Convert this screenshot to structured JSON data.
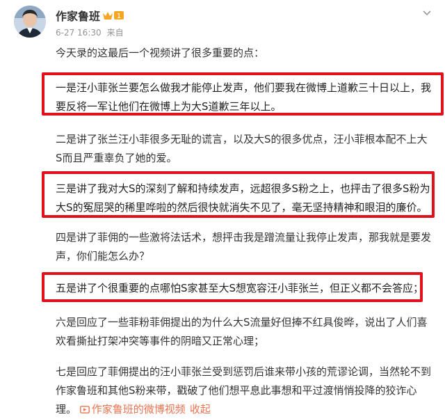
{
  "post": {
    "author": "作家鲁班",
    "badge_level": "1",
    "timestamp": "6-27 16:30",
    "source": "来自",
    "paragraphs": [
      "今天录的这最后一个视频讲了很多重要的点：",
      "一是汪小菲张兰要怎么做我才能停止发声，他们要我在微博上道歉三十日以上，我要反将一军让他们在微博上为大S道歉三年以上。",
      "二是讲了张兰汪小菲很多无耻的谎言，以及大S的很多优点，汪小菲根本配不上大S而且严重辜负了她的爱。",
      "三是讲了我对大S的深刻了解和持续发声，远超很多S粉之上，也抨击了很多S粉为大S的冤屈哭的稀里哗啦的然后很快就消失不见了，毫无坚持精神和眼泪的廉价。",
      "四是讲了菲佣的一些激将法话术，想抨击我是蹭流量让我停止发声，那我就是要发声，你们能怎么办？",
      "五是讲了个很重要的点哪怕S家甚至大S想宽容汪小菲张兰，但正义都不会答应；",
      "六是回应了一些菲粉菲佣提出的为什么大S流量好但捧不红具俊晔，说出了人们喜欢看撕扯打架冲突等事件的阴暗又正常心理；",
      "七是回应了菲佣提出的汪小菲张兰受到惩罚后谁来带小孩的荒谬论调，当然轮不到作家鲁班和其他S粉来带，戳破了他们想平息此事想和平过渡悄悄投降的狡诈心理。"
    ],
    "video_link": "作家鲁班的微博视频",
    "collapse_link": "收起"
  },
  "colors": {
    "highlight_box": "#e0111c",
    "link": "#eb7350",
    "badge": "#f5a623",
    "meta": "#939393"
  },
  "icons": [
    "avatar",
    "vip-crown-badge",
    "chevron-down-icon",
    "video-icon"
  ]
}
